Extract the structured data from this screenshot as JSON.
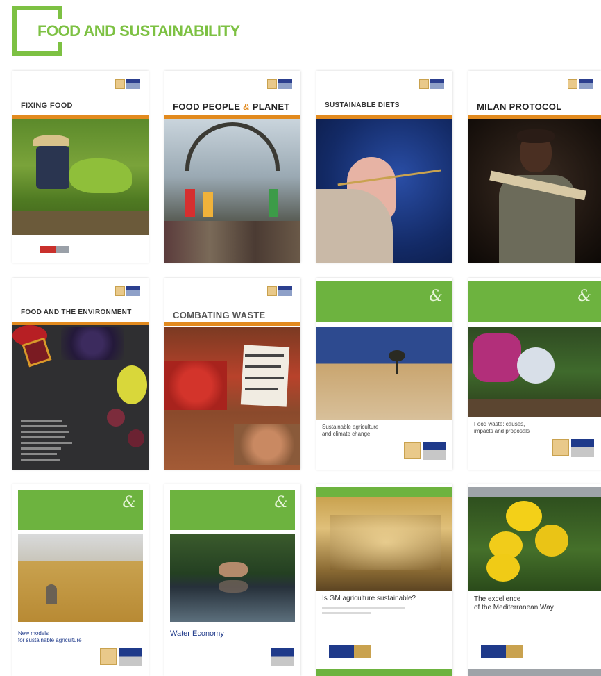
{
  "page": {
    "title": "FOOD AND SUSTAINABILITY",
    "brand_color": "#7dc143"
  },
  "cards": [
    {
      "title": "FIXING FOOD"
    },
    {
      "title_a": "FOOD PEOPLE",
      "title_amp": "&",
      "title_b": "PLANET"
    },
    {
      "title": "SUSTAINABLE DIETS"
    },
    {
      "title": "MILAN PROTOCOL"
    },
    {
      "title": "FOOD AND THE ENVIRONMENT"
    },
    {
      "title": "COMBATING WASTE"
    },
    {
      "amp": "&",
      "subtitle_l1": "Sustainable agriculture",
      "subtitle_l2": "and climate change"
    },
    {
      "amp": "&",
      "subtitle_l1": "Food waste: causes,",
      "subtitle_l2": "impacts and proposals"
    },
    {
      "amp": "&",
      "subtitle_l1": "New models",
      "subtitle_l2": "for sustainable agriculture"
    },
    {
      "amp": "&",
      "subtitle_l1": "Water Economy"
    },
    {
      "subtitle_l1": "Is GM agriculture sustainable?"
    },
    {
      "subtitle_l1": "The excellence",
      "subtitle_l2": "of the Mediterranean Way"
    }
  ],
  "icons": [
    "barilla-logo-icon",
    "ampersand-icon"
  ]
}
